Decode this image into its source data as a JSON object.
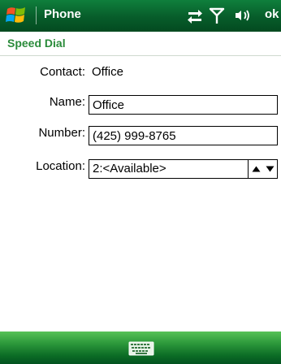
{
  "titlebar": {
    "app_title": "Phone",
    "ok_label": "ok",
    "status_icons": [
      "connectivity-icon",
      "signal-icon",
      "volume-icon"
    ],
    "start_icon": "windows-flag-icon"
  },
  "header": {
    "title": "Speed Dial"
  },
  "form": {
    "contact": {
      "label": "Contact:",
      "value": "Office"
    },
    "name": {
      "label": "Name:",
      "value": "Office"
    },
    "number": {
      "label": "Number:",
      "value": "(425) 999-8765"
    },
    "location": {
      "label": "Location:",
      "value": "2:<Available>"
    }
  },
  "softkeys": {
    "center_icon": "keyboard-icon"
  },
  "colors": {
    "titlebar_green": "#075c2a",
    "header_title_green": "#2a8b3a",
    "softkey_green": "#2e9a3c"
  }
}
